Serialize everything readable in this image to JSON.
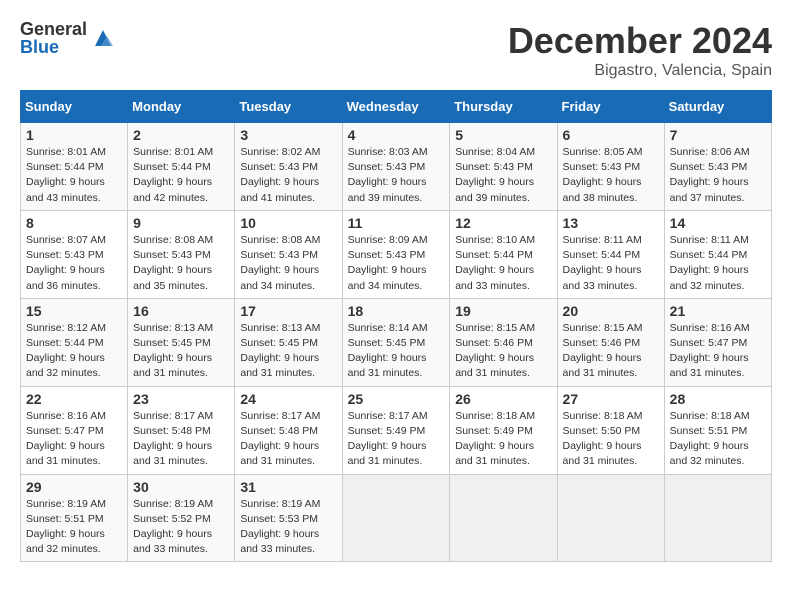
{
  "logo": {
    "general": "General",
    "blue": "Blue"
  },
  "title": "December 2024",
  "location": "Bigastro, Valencia, Spain",
  "days_header": [
    "Sunday",
    "Monday",
    "Tuesday",
    "Wednesday",
    "Thursday",
    "Friday",
    "Saturday"
  ],
  "weeks": [
    [
      {
        "day": "1",
        "sunrise": "Sunrise: 8:01 AM",
        "sunset": "Sunset: 5:44 PM",
        "daylight": "Daylight: 9 hours and 43 minutes."
      },
      {
        "day": "2",
        "sunrise": "Sunrise: 8:01 AM",
        "sunset": "Sunset: 5:44 PM",
        "daylight": "Daylight: 9 hours and 42 minutes."
      },
      {
        "day": "3",
        "sunrise": "Sunrise: 8:02 AM",
        "sunset": "Sunset: 5:43 PM",
        "daylight": "Daylight: 9 hours and 41 minutes."
      },
      {
        "day": "4",
        "sunrise": "Sunrise: 8:03 AM",
        "sunset": "Sunset: 5:43 PM",
        "daylight": "Daylight: 9 hours and 39 minutes."
      },
      {
        "day": "5",
        "sunrise": "Sunrise: 8:04 AM",
        "sunset": "Sunset: 5:43 PM",
        "daylight": "Daylight: 9 hours and 39 minutes."
      },
      {
        "day": "6",
        "sunrise": "Sunrise: 8:05 AM",
        "sunset": "Sunset: 5:43 PM",
        "daylight": "Daylight: 9 hours and 38 minutes."
      },
      {
        "day": "7",
        "sunrise": "Sunrise: 8:06 AM",
        "sunset": "Sunset: 5:43 PM",
        "daylight": "Daylight: 9 hours and 37 minutes."
      }
    ],
    [
      {
        "day": "8",
        "sunrise": "Sunrise: 8:07 AM",
        "sunset": "Sunset: 5:43 PM",
        "daylight": "Daylight: 9 hours and 36 minutes."
      },
      {
        "day": "9",
        "sunrise": "Sunrise: 8:08 AM",
        "sunset": "Sunset: 5:43 PM",
        "daylight": "Daylight: 9 hours and 35 minutes."
      },
      {
        "day": "10",
        "sunrise": "Sunrise: 8:08 AM",
        "sunset": "Sunset: 5:43 PM",
        "daylight": "Daylight: 9 hours and 34 minutes."
      },
      {
        "day": "11",
        "sunrise": "Sunrise: 8:09 AM",
        "sunset": "Sunset: 5:43 PM",
        "daylight": "Daylight: 9 hours and 34 minutes."
      },
      {
        "day": "12",
        "sunrise": "Sunrise: 8:10 AM",
        "sunset": "Sunset: 5:44 PM",
        "daylight": "Daylight: 9 hours and 33 minutes."
      },
      {
        "day": "13",
        "sunrise": "Sunrise: 8:11 AM",
        "sunset": "Sunset: 5:44 PM",
        "daylight": "Daylight: 9 hours and 33 minutes."
      },
      {
        "day": "14",
        "sunrise": "Sunrise: 8:11 AM",
        "sunset": "Sunset: 5:44 PM",
        "daylight": "Daylight: 9 hours and 32 minutes."
      }
    ],
    [
      {
        "day": "15",
        "sunrise": "Sunrise: 8:12 AM",
        "sunset": "Sunset: 5:44 PM",
        "daylight": "Daylight: 9 hours and 32 minutes."
      },
      {
        "day": "16",
        "sunrise": "Sunrise: 8:13 AM",
        "sunset": "Sunset: 5:45 PM",
        "daylight": "Daylight: 9 hours and 31 minutes."
      },
      {
        "day": "17",
        "sunrise": "Sunrise: 8:13 AM",
        "sunset": "Sunset: 5:45 PM",
        "daylight": "Daylight: 9 hours and 31 minutes."
      },
      {
        "day": "18",
        "sunrise": "Sunrise: 8:14 AM",
        "sunset": "Sunset: 5:45 PM",
        "daylight": "Daylight: 9 hours and 31 minutes."
      },
      {
        "day": "19",
        "sunrise": "Sunrise: 8:15 AM",
        "sunset": "Sunset: 5:46 PM",
        "daylight": "Daylight: 9 hours and 31 minutes."
      },
      {
        "day": "20",
        "sunrise": "Sunrise: 8:15 AM",
        "sunset": "Sunset: 5:46 PM",
        "daylight": "Daylight: 9 hours and 31 minutes."
      },
      {
        "day": "21",
        "sunrise": "Sunrise: 8:16 AM",
        "sunset": "Sunset: 5:47 PM",
        "daylight": "Daylight: 9 hours and 31 minutes."
      }
    ],
    [
      {
        "day": "22",
        "sunrise": "Sunrise: 8:16 AM",
        "sunset": "Sunset: 5:47 PM",
        "daylight": "Daylight: 9 hours and 31 minutes."
      },
      {
        "day": "23",
        "sunrise": "Sunrise: 8:17 AM",
        "sunset": "Sunset: 5:48 PM",
        "daylight": "Daylight: 9 hours and 31 minutes."
      },
      {
        "day": "24",
        "sunrise": "Sunrise: 8:17 AM",
        "sunset": "Sunset: 5:48 PM",
        "daylight": "Daylight: 9 hours and 31 minutes."
      },
      {
        "day": "25",
        "sunrise": "Sunrise: 8:17 AM",
        "sunset": "Sunset: 5:49 PM",
        "daylight": "Daylight: 9 hours and 31 minutes."
      },
      {
        "day": "26",
        "sunrise": "Sunrise: 8:18 AM",
        "sunset": "Sunset: 5:49 PM",
        "daylight": "Daylight: 9 hours and 31 minutes."
      },
      {
        "day": "27",
        "sunrise": "Sunrise: 8:18 AM",
        "sunset": "Sunset: 5:50 PM",
        "daylight": "Daylight: 9 hours and 31 minutes."
      },
      {
        "day": "28",
        "sunrise": "Sunrise: 8:18 AM",
        "sunset": "Sunset: 5:51 PM",
        "daylight": "Daylight: 9 hours and 32 minutes."
      }
    ],
    [
      {
        "day": "29",
        "sunrise": "Sunrise: 8:19 AM",
        "sunset": "Sunset: 5:51 PM",
        "daylight": "Daylight: 9 hours and 32 minutes."
      },
      {
        "day": "30",
        "sunrise": "Sunrise: 8:19 AM",
        "sunset": "Sunset: 5:52 PM",
        "daylight": "Daylight: 9 hours and 33 minutes."
      },
      {
        "day": "31",
        "sunrise": "Sunrise: 8:19 AM",
        "sunset": "Sunset: 5:53 PM",
        "daylight": "Daylight: 9 hours and 33 minutes."
      },
      null,
      null,
      null,
      null
    ]
  ]
}
